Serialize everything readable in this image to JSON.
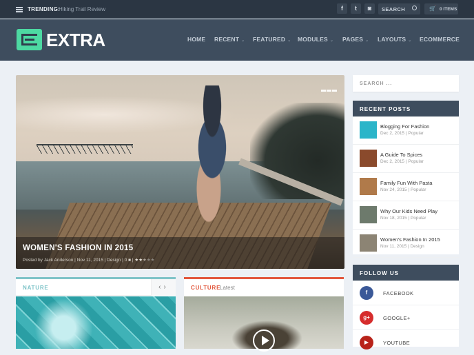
{
  "topbar": {
    "trending_label": "TRENDING:",
    "trending_value": "Hiking Trail Review",
    "social": [
      {
        "name": "facebook",
        "glyph": "f"
      },
      {
        "name": "twitter",
        "glyph": "t"
      },
      {
        "name": "instagram",
        "glyph": "◙"
      }
    ],
    "search_placeholder": "SEARCH",
    "cart_label": "0 ITEMS",
    "cart_glyph": "🛒"
  },
  "header": {
    "logo_text": "EXTRA",
    "nav": [
      {
        "label": "HOME",
        "dropdown": false
      },
      {
        "label": "RECENT",
        "dropdown": true
      },
      {
        "label": "FEATURED",
        "dropdown": true
      },
      {
        "label": "MODULES",
        "dropdown": true
      },
      {
        "label": "PAGES",
        "dropdown": true
      },
      {
        "label": "LAYOUTS",
        "dropdown": true
      },
      {
        "label": "ECOMMERCE",
        "dropdown": false
      }
    ],
    "chevron": "⌄"
  },
  "featured": {
    "title": "WOMEN'S FASHION IN 2015",
    "meta_prefix": "Posted by Jack Anderson | Nov 11, 2015 | Design | 0",
    "comment_glyph": "■",
    "rating": 2.5,
    "rating_max": 5
  },
  "modules": {
    "nature": {
      "title": "NATURE",
      "prev": "‹",
      "next": "›"
    },
    "culture": {
      "title": "CULTURE",
      "subtitle": "Latest"
    }
  },
  "sidebar": {
    "search_placeholder": "SEARCH ...",
    "recent_posts": {
      "title": "RECENT POSTS",
      "items": [
        {
          "title": "Blogging For Fashion",
          "meta": "Dec 2, 2015 | Popular",
          "thumb_color": "#2bb5c9"
        },
        {
          "title": "A Guide To Spices",
          "meta": "Dec 2, 2015 | Popular",
          "thumb_color": "#8a4a2c"
        },
        {
          "title": "Family Fun With Pasta",
          "meta": "Nov 24, 2015 | Popular",
          "thumb_color": "#b07a4a"
        },
        {
          "title": "Why Our Kids Need Play",
          "meta": "Nov 18, 2015 | Popular",
          "thumb_color": "#6d7a6c"
        },
        {
          "title": "Women's Fashion In 2015",
          "meta": "Nov 11, 2015 | Design",
          "thumb_color": "#8c8474"
        }
      ]
    },
    "follow_us": {
      "title": "FOLLOW US",
      "items": [
        {
          "label": "FACEBOOK",
          "glyph": "f",
          "color": "#3b5998"
        },
        {
          "label": "GOOGLE+",
          "glyph": "g+",
          "color": "#d62d2d"
        },
        {
          "label": "YOUTUBE",
          "glyph": "▶",
          "color": "#b8231a"
        }
      ]
    }
  }
}
